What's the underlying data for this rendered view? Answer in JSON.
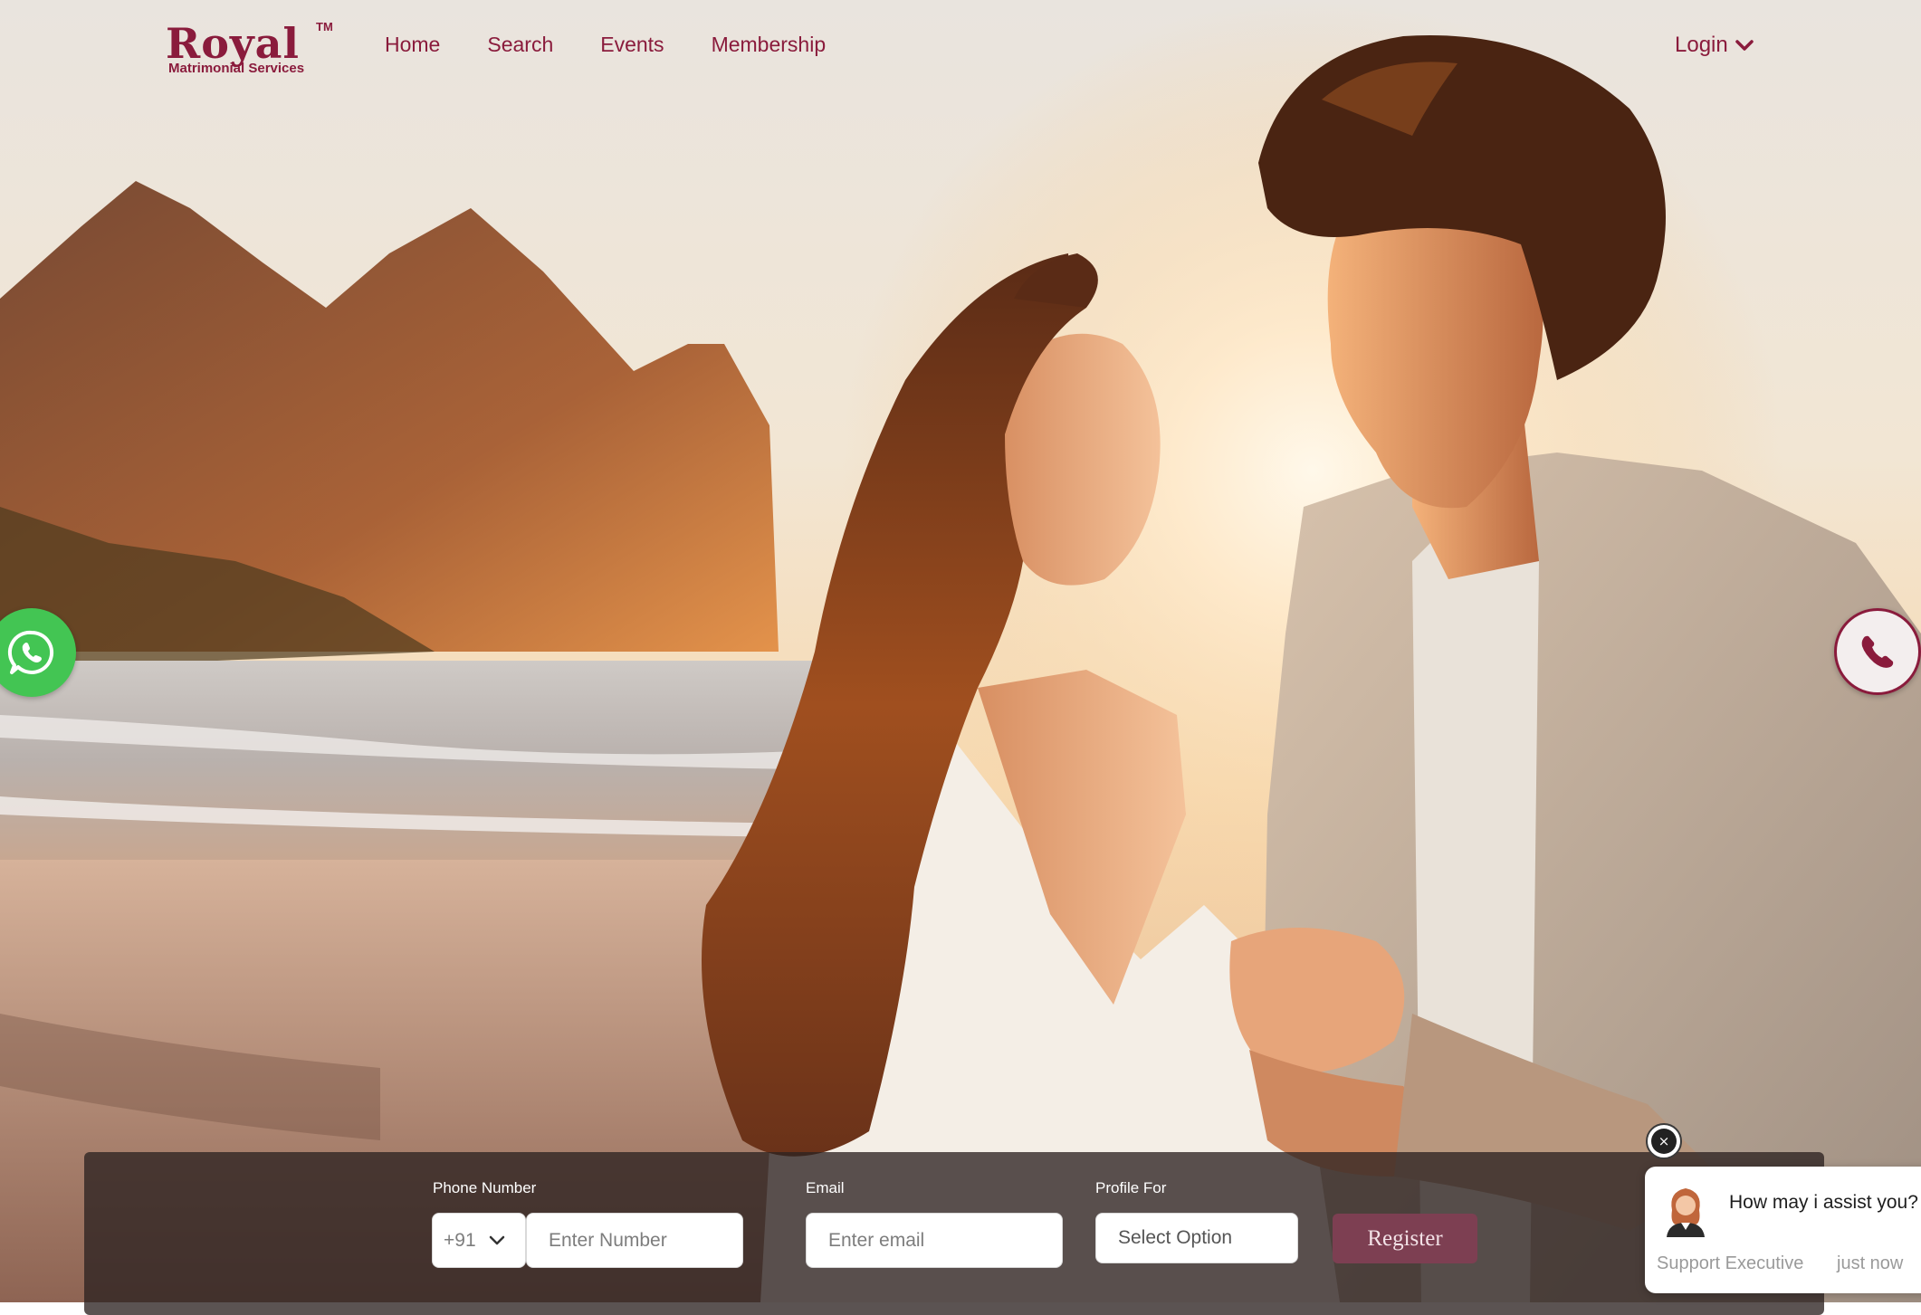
{
  "brand": {
    "name": "Royal",
    "trademark": "TM",
    "tagline": "Matrimonial Services",
    "color": "#8a1b3c"
  },
  "nav": {
    "items": [
      {
        "label": "Home"
      },
      {
        "label": "Search"
      },
      {
        "label": "Events"
      },
      {
        "label": "Membership"
      }
    ],
    "login_label": "Login"
  },
  "hero": {
    "image": "couple-on-beach-at-sunset"
  },
  "floating": {
    "whatsapp_icon": "whatsapp-icon",
    "phone_icon": "phone-icon"
  },
  "registration": {
    "phone_label": "Phone Number",
    "country_code": "+91",
    "phone_placeholder": "Enter Number",
    "email_label": "Email",
    "email_placeholder": "Enter email",
    "profile_label": "Profile For",
    "profile_selected": "Select Option",
    "register_label": "Register"
  },
  "chat": {
    "close_label": "×",
    "message": "How may i assist you?",
    "sender": "Support Executive",
    "time": "just now"
  }
}
